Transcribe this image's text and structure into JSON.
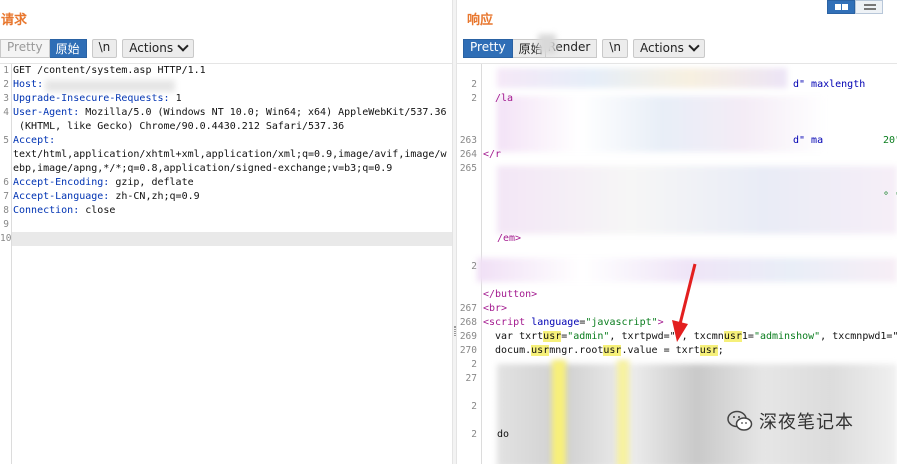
{
  "request": {
    "title": "请求",
    "tabs": [
      "Pretty",
      "原始",
      "\\n"
    ],
    "actions_label": "Actions",
    "lines": [
      {
        "n": "1",
        "text": "GET /content/system.asp HTTP/1.1"
      },
      {
        "n": "2",
        "header": "Host:",
        "value": ""
      },
      {
        "n": "3",
        "header": "Upgrade-Insecure-Requests:",
        "value": " 1"
      },
      {
        "n": "4",
        "header": "User-Agent:",
        "value": " Mozilla/5.0 (Windows NT 10.0; Win64; x64) AppleWebKit/537.36"
      },
      {
        "n": "",
        "text": " (KHTML, like Gecko) Chrome/90.0.4430.212 Safari/537.36"
      },
      {
        "n": "5",
        "header": "Accept:",
        "value": ""
      },
      {
        "n": "",
        "text": "text/html,application/xhtml+xml,application/xml;q=0.9,image/avif,image/w"
      },
      {
        "n": "",
        "text": "ebp,image/apng,*/*;q=0.8,application/signed-exchange;v=b3;q=0.9"
      },
      {
        "n": "6",
        "header": "Accept-Encoding:",
        "value": " gzip, deflate"
      },
      {
        "n": "7",
        "header": "Accept-Language:",
        "value": " zh-CN,zh;q=0.9"
      },
      {
        "n": "8",
        "header": "Connection:",
        "value": " close"
      },
      {
        "n": "9",
        "text": ""
      },
      {
        "n": "10",
        "text": ""
      }
    ]
  },
  "response": {
    "title": "响应",
    "tabs": [
      "Pretty",
      "原始",
      "Render",
      "\\n"
    ],
    "actions_label": "Actions",
    "frag_maxlength": "d\" maxlength",
    "frag_max2": "d\" ma",
    "frag_20": "20\"",
    "frag_la": "/la",
    "frag_r": "</r",
    "frag_deg": "° \"~\"",
    "frag_em": "/em>",
    "frag_button_close": "</button>",
    "frag_br": "<br>",
    "script_open_tag": "<script",
    "script_attr": "language",
    "script_val": "\"javascript\"",
    "line269_a": "var txrt",
    "line269_usr": "usr",
    "line269_b": "=",
    "line269_admin": "\"admin\"",
    "line269_c": ", txrtpwd=\"",
    "line269_d": "\", txcmn",
    "line269_usr2": "usr",
    "line269_e": "1=",
    "line269_adminshow": "\"adminshow\"",
    "line269_f": ", txcmnpwd1=\"",
    "line270_a": "docum",
    "line270_b": ".",
    "line270_usr": "usr",
    "line270_c": "mngr.root",
    "line270_usr2": "usr",
    "line270_d": ".value = txrt",
    "line270_usr3": "usr",
    "line270_e": ";",
    "frag_do": "do",
    "line_numbers": [
      "2",
      "2",
      "263",
      "264",
      "265",
      "2",
      "267",
      "268",
      "269",
      "270",
      "2",
      "27",
      "2",
      "2"
    ]
  },
  "watermark": {
    "text": "深夜笔记本"
  },
  "colors": {
    "accent_title": "#e8772e",
    "tab_on": "#2f6eb6",
    "arrow": "#e31f1f",
    "highlight": "#f6f07a"
  }
}
